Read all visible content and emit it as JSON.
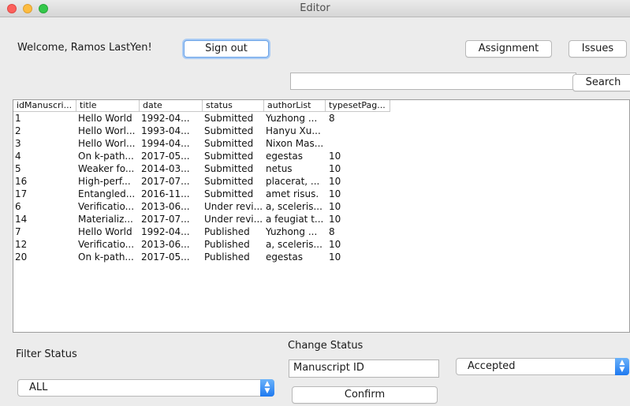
{
  "window": {
    "title": "Editor"
  },
  "header": {
    "welcome_text": "Welcome, Ramos LastYen!",
    "sign_out_label": "Sign out",
    "assignment_label": "Assignment",
    "issues_label": "Issues"
  },
  "search": {
    "value": "",
    "button_label": "Search"
  },
  "table": {
    "columns": [
      "idManuscri...",
      "title",
      "date",
      "status",
      "authorList",
      "typesetPag..."
    ],
    "rows": [
      [
        "1",
        "Hello World",
        "1992-04...",
        "Submitted",
        "Yuzhong ...",
        "8"
      ],
      [
        "2",
        "Hello Worl...",
        "1993-04...",
        "Submitted",
        "Hanyu Xu...",
        ""
      ],
      [
        "3",
        "Hello Worl...",
        "1994-04...",
        "Submitted",
        "Nixon Mas...",
        ""
      ],
      [
        "4",
        "On k-path...",
        "2017-05...",
        "Submitted",
        "egestas",
        "10"
      ],
      [
        "5",
        "Weaker fo...",
        "2014-03...",
        "Submitted",
        "netus",
        "10"
      ],
      [
        "16",
        "High-perf...",
        "2017-07...",
        "Submitted",
        "placerat, ...",
        "10"
      ],
      [
        "17",
        "Entangled...",
        "2016-11...",
        "Submitted",
        "amet risus.",
        "10"
      ],
      [
        "6",
        "Verificatio...",
        "2013-06...",
        "Under revi...",
        "a, sceleris...",
        "10"
      ],
      [
        "14",
        "Materializ...",
        "2017-07...",
        "Under revi...",
        "a feugiat t...",
        "10"
      ],
      [
        "7",
        "Hello World",
        "1992-04...",
        "Published",
        "Yuzhong ...",
        "8"
      ],
      [
        "12",
        "Verificatio...",
        "2013-06...",
        "Published",
        "a, sceleris...",
        "10"
      ],
      [
        "20",
        "On k-path...",
        "2017-05...",
        "Published",
        "egestas",
        "10"
      ]
    ]
  },
  "filter": {
    "label": "Filter Status",
    "selected": "ALL"
  },
  "change_status": {
    "label": "Change Status",
    "manuscript_id_value": "Manuscript ID",
    "status_selected": "Accepted",
    "confirm_label": "Confirm"
  },
  "icons": {
    "select_arrow": "up-down-chevron-icon"
  },
  "colors": {
    "select_accent": "#1e79f0",
    "focus_ring": "#a9cbf4"
  }
}
